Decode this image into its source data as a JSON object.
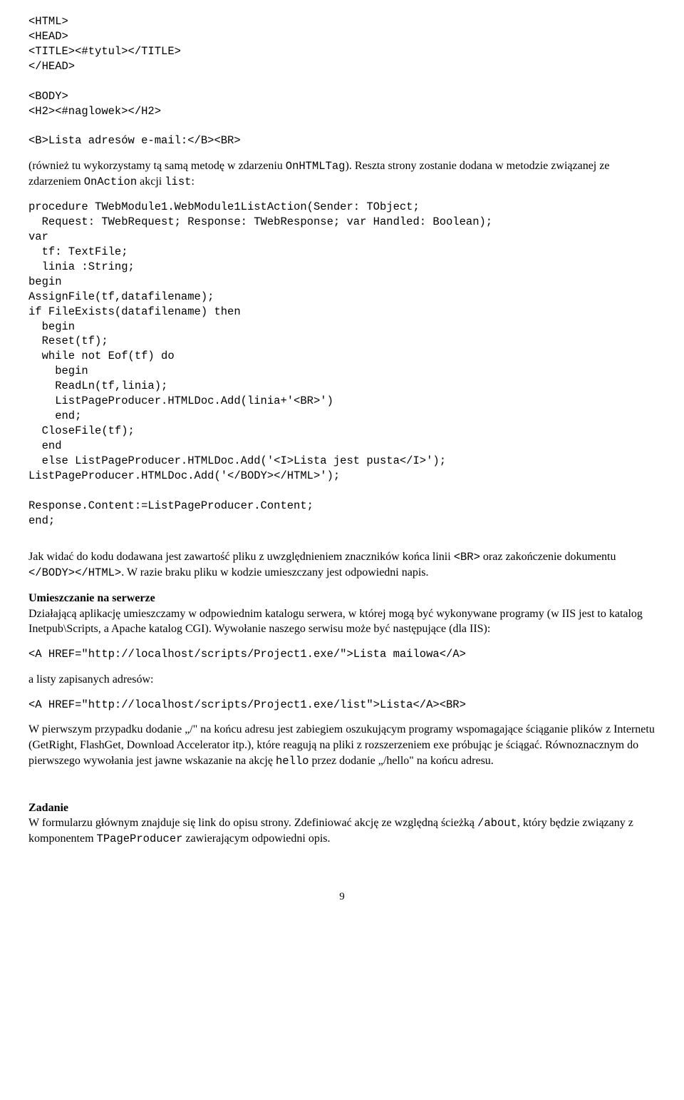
{
  "code1": "<HTML>\n<HEAD>\n<TITLE><#tytul></TITLE>\n</HEAD>\n\n<BODY>\n<H2><#naglowek></H2>\n\n<B>Lista adresów e-mail:</B><BR>",
  "intro1a": "(również tu wykorzystamy tą samą metodę w zdarzeniu ",
  "intro1b": "OnHTMLTag",
  "intro1c": "). Reszta strony zostanie dodana w metodzie związanej ze zdarzeniem ",
  "intro1d": "OnAction",
  "intro1e": " akcji ",
  "intro1f": "list",
  "intro1g": ":",
  "code2": "procedure TWebModule1.WebModule1ListAction(Sender: TObject;\n  Request: TWebRequest; Response: TWebResponse; var Handled: Boolean);\nvar\n  tf: TextFile;\n  linia :String;\nbegin\nAssignFile(tf,datafilename);\nif FileExists(datafilename) then\n  begin\n  Reset(tf);\n  while not Eof(tf) do\n    begin\n    ReadLn(tf,linia);\n    ListPageProducer.HTMLDoc.Add(linia+'<BR>')\n    end;\n  CloseFile(tf);\n  end\n  else ListPageProducer.HTMLDoc.Add('<I>Lista jest pusta</I>');\nListPageProducer.HTMLDoc.Add('</BODY></HTML>');\n\nResponse.Content:=ListPageProducer.Content;\nend;",
  "para2a": "Jak widać do kodu dodawana jest zawartość pliku z uwzględnieniem znaczników końca linii ",
  "para2b": "<BR>",
  "para2c": " oraz zakończenie dokumentu ",
  "para2d": "</BODY></HTML>",
  "para2e": ". W razie braku pliku w kodzie umieszczany jest odpowiedni napis.",
  "heading3": "Umieszczanie na serwerze",
  "para3": "Działającą aplikację umieszczamy w odpowiednim katalogu serwera, w której mogą być wykonywane programy (w IIS jest to katalog Inetpub\\Scripts, a Apache katalog CGI). Wywołanie naszego serwisu może być następujące (dla IIS):",
  "code3": "<A HREF=\"http://localhost/scripts/Project1.exe/\">Lista mailowa</A>",
  "para4": "a listy zapisanych adresów:",
  "code4": "<A HREF=\"http://localhost/scripts/Project1.exe/list\">Lista</A><BR>",
  "para5a": "W pierwszym przypadku dodanie „/\" na końcu adresu jest zabiegiem oszukującym programy wspomagające ściąganie plików z Internetu (GetRight, FlashGet, Download Accelerator itp.), które reagują na pliki z rozszerzeniem exe próbując je ściągać. Równoznacznym do pierwszego wywołania jest jawne wskazanie na akcję ",
  "para5b": "hello",
  "para5c": " przez dodanie „/hello\" na końcu adresu.",
  "heading6": "Zadanie",
  "para6a": "W formularzu głównym znajduje się link do opisu strony. Zdefiniować akcję ze względną ścieżką ",
  "para6b": "/about",
  "para6c": ", który będzie związany z komponentem ",
  "para6d": "TPageProducer",
  "para6e": " zawierającym odpowiedni opis.",
  "page_number": "9"
}
